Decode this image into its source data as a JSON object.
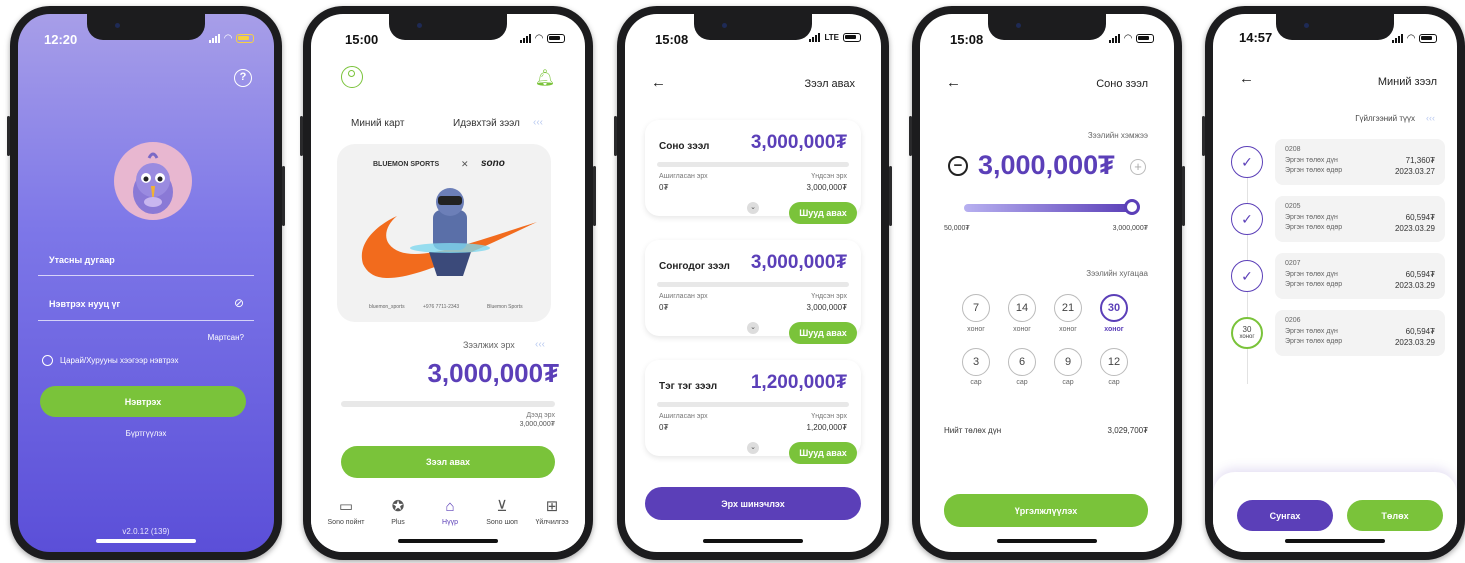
{
  "screens": [
    {
      "time": "12:20",
      "phone_label": "Утасны дугаар",
      "password_label": "Нэвтрэх нууц үг",
      "forgot": "Мартсан?",
      "biometric": "Царай/Хурууны хээгээр нэвтрэх",
      "login_button": "Нэвтрэх",
      "register": "Бүртгүүлэх",
      "version": "v2.0.12 (139)"
    },
    {
      "time": "15:00",
      "tab_my_card": "Миний карт",
      "tab_active_loan": "Идэвхтэй зээл",
      "card_brand_left": "BLUEMON SPORTS",
      "card_cross": "✕",
      "card_brand_right": "sono",
      "card_footer": [
        "bluemon_sports",
        "+976 7711-2343",
        "Bluemon Sports"
      ],
      "limit_label": "Зээлжих эрх",
      "limit_amount": "3,000,000₮",
      "max_label": "Дээд эрх",
      "max_amount": "3,000,000₮",
      "loan_button": "Зээл авах",
      "nav": [
        "Sono пойнт",
        "Plus",
        "Нүүр",
        "Sono шоп",
        "Үйлчилгээ"
      ]
    },
    {
      "time": "15:08",
      "network": "LTE",
      "header": "Зээл авах",
      "loans": [
        {
          "name": "Соно зээл",
          "amount": "3,000,000₮",
          "used_label": "Ашигласан эрх",
          "used": "0₮",
          "base_label": "Үндсэн эрх",
          "base": "3,000,000₮",
          "button": "Шууд авах"
        },
        {
          "name": "Сонгодог зээл",
          "amount": "3,000,000₮",
          "used_label": "Ашигласан эрх",
          "used": "0₮",
          "base_label": "Үндсэн эрх",
          "base": "3,000,000₮",
          "button": "Шууд авах"
        },
        {
          "name": "Тэг тэг зээл",
          "amount": "1,200,000₮",
          "used_label": "Ашигласан эрх",
          "used": "0₮",
          "base_label": "Үндсэн эрх",
          "base": "1,200,000₮",
          "button": "Шууд авах"
        }
      ],
      "refresh_button": "Эрх шинэчлэх"
    },
    {
      "time": "15:08",
      "header": "Соно зээл",
      "amount_label": "Зээлийн хэмжээ",
      "amount": "3,000,000₮",
      "slider_fraction": 1.0,
      "slider_min": "50,000₮",
      "slider_max": "3,000,000₮",
      "term_label": "Зээлийн хугацаа",
      "days": [
        "7",
        "14",
        "21",
        "30"
      ],
      "day_unit": "хоног",
      "months": [
        "3",
        "6",
        "9",
        "12"
      ],
      "month_unit": "сар",
      "total_label": "Нийт төлөх дүн",
      "total": "3,029,700₮",
      "continue_button": "Үргэлжлүүлэх"
    },
    {
      "time": "14:57",
      "header": "Миний зээл",
      "history_label": "Гүйлгээний түүх",
      "pending_days": "30",
      "pending_unit": "хоног",
      "items": [
        {
          "code": "0208",
          "label1": "Эргэн төлөх дүн",
          "label2": "Эргэн төлөх өдөр",
          "amount": "71,360₮",
          "date": "2023.03.27"
        },
        {
          "code": "0205",
          "label1": "Эргэн төлөх дүн",
          "label2": "Эргэн төлөх өдөр",
          "amount": "60,594₮",
          "date": "2023.03.29"
        },
        {
          "code": "0207",
          "label1": "Эргэн төлөх дүн",
          "label2": "Эргэн төлөх өдөр",
          "amount": "60,594₮",
          "date": "2023.03.29"
        },
        {
          "code": "0206",
          "label1": "Эргэн төлөх дүн",
          "label2": "Эргэн төлөх өдөр",
          "amount": "60,594₮",
          "date": "2023.03.29"
        }
      ],
      "extend_button": "Сунгах",
      "pay_button": "Төлөх"
    }
  ]
}
